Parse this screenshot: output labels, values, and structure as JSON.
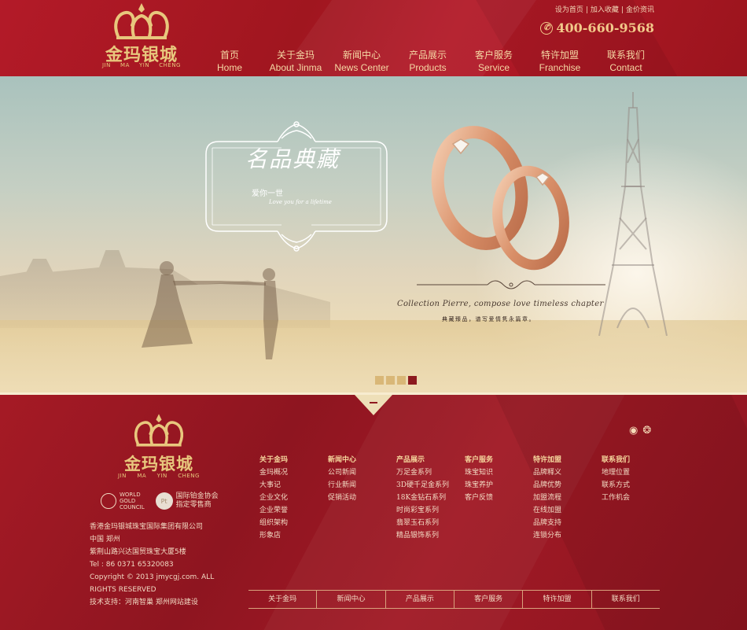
{
  "header": {
    "logo": {
      "name_cn": "金玛银城",
      "name_en": [
        "JIN",
        "MA",
        "YIN",
        "CHENG"
      ]
    },
    "top_links": [
      "设为首页",
      "加入收藏",
      "金价资讯"
    ],
    "phone": "400-660-9568",
    "nav": [
      {
        "cn": "首页",
        "en": "Home"
      },
      {
        "cn": "关于金玛",
        "en": "About Jinma"
      },
      {
        "cn": "新闻中心",
        "en": "News Center"
      },
      {
        "cn": "产品展示",
        "en": "Products"
      },
      {
        "cn": "客户服务",
        "en": "Service"
      },
      {
        "cn": "特许加盟",
        "en": "Franchise"
      },
      {
        "cn": "联系我们",
        "en": "Contact"
      }
    ]
  },
  "banner": {
    "title": "名品典藏",
    "subtitle": "爱你一世",
    "subtitle_en": "Love you for a lifetime",
    "collection_en": "Collection  Pierre, compose love timeless chapter",
    "collection_cn": "典藏臻品，谱写爱情隽永篇章。",
    "slides": 4,
    "active_slide": 4
  },
  "footer": {
    "logo": {
      "name_cn": "金玛银城",
      "name_en": [
        "JIN",
        "MA",
        "YIN",
        "CHENG"
      ]
    },
    "partners": {
      "wgc": [
        "WORLD",
        "GOLD",
        "COUNCIL"
      ],
      "pt": [
        "国际铂金协会",
        "指定零售商"
      ]
    },
    "company": [
      "香港金玛银城珠宝国际集团有限公司",
      "中国  郑州",
      "紫荆山路兴达国贸珠宝大厦5楼",
      "Tel : 86 0371 65320083",
      "Copyright © 2013 jmycgj.com. ALL",
      "RIGHTS RESERVED",
      "技术支持：河南智巢  郑州网站建设"
    ],
    "columns": [
      {
        "title": "关于金玛",
        "links": [
          "金玛概况",
          "大事记",
          "企业文化",
          "企业荣誉",
          "组织架构",
          "形象店"
        ]
      },
      {
        "title": "新闻中心",
        "links": [
          "公司新闻",
          "行业新闻",
          "促销活动"
        ]
      },
      {
        "title": "产品展示",
        "links": [
          "万足金系列",
          "3D硬千足金系列",
          "18K金钻石系列",
          "时尚彩宝系列",
          "翡翠玉石系列",
          "精品银饰系列"
        ]
      },
      {
        "title": "客户服务",
        "links": [
          "珠宝知识",
          "珠宝养护",
          "客户反馈"
        ]
      },
      {
        "title": "特许加盟",
        "links": [
          "品牌释义",
          "品牌优势",
          "加盟流程",
          "在线加盟",
          "品牌支持",
          "连锁分布"
        ]
      },
      {
        "title": "联系我们",
        "links": [
          "地理位置",
          "联系方式",
          "工作机会"
        ]
      }
    ],
    "bottom_nav": [
      "关于金玛",
      "新闻中心",
      "产品展示",
      "客户服务",
      "特许加盟",
      "联系我们"
    ]
  },
  "colors": {
    "primary_red": "#a0161f",
    "gold": "#e8c77d",
    "nav_text": "#f5d8a4",
    "active_dot": "#8c1a1f",
    "dot": "#d9b777"
  }
}
